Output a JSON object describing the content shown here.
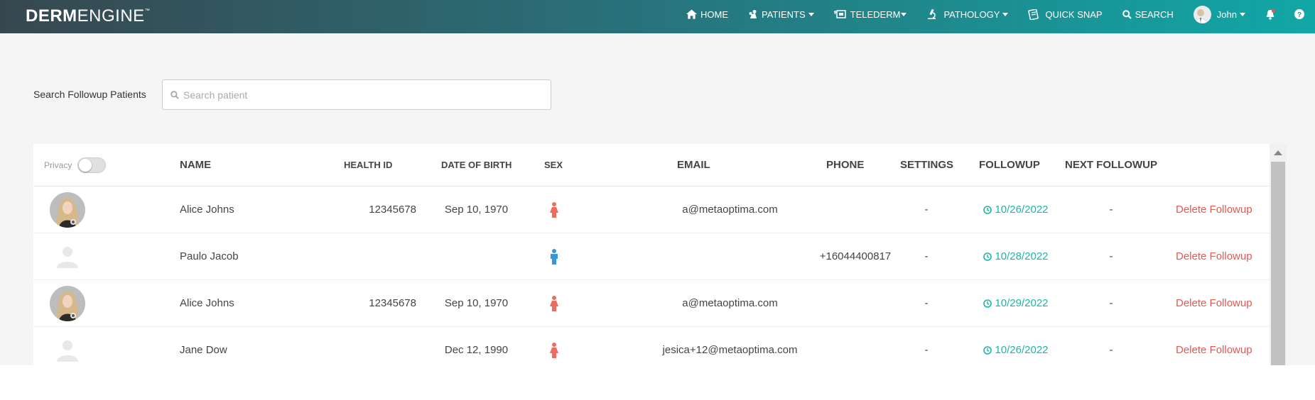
{
  "brand": {
    "bold": "DERM",
    "light": "ENGINE",
    "tm": "™"
  },
  "nav": {
    "home": "HOME",
    "patients": "PATIENTS",
    "telederm": "TELEDERM",
    "pathology": "PATHOLOGY",
    "quick_snap": "QUICK SNAP",
    "search": "SEARCH",
    "user": "John"
  },
  "search": {
    "label": "Search Followup Patients",
    "placeholder": "Search patient",
    "value": ""
  },
  "table": {
    "privacy_label": "Privacy",
    "privacy_on": false,
    "headers": {
      "name": "NAME",
      "health_id": "HEALTH ID",
      "dob": "DATE OF BIRTH",
      "sex": "SEX",
      "email": "EMAIL",
      "phone": "PHONE",
      "settings": "SETTINGS",
      "followup": "FOLLOWUP",
      "next_followup": "NEXT FOLLOWUP"
    },
    "rows": [
      {
        "name": "Alice Johns",
        "health_id": "12345678",
        "dob": "Sep 10, 1970",
        "sex": "female",
        "email": "a@metaoptima.com",
        "phone": "",
        "settings": "-",
        "followup": "10/26/2022",
        "next_followup": "-",
        "action": "Delete Followup",
        "has_photo": true
      },
      {
        "name": "Paulo Jacob",
        "health_id": "",
        "dob": "",
        "sex": "male",
        "email": "",
        "phone": "+16044400817",
        "settings": "-",
        "followup": "10/28/2022",
        "next_followup": "-",
        "action": "Delete Followup",
        "has_photo": false
      },
      {
        "name": "Alice Johns",
        "health_id": "12345678",
        "dob": "Sep 10, 1970",
        "sex": "female",
        "email": "a@metaoptima.com",
        "phone": "",
        "settings": "-",
        "followup": "10/29/2022",
        "next_followup": "-",
        "action": "Delete Followup",
        "has_photo": true
      },
      {
        "name": "Jane Dow",
        "health_id": "",
        "dob": "Dec 12, 1990",
        "sex": "female",
        "email": "jesica+12@metaoptima.com",
        "phone": "",
        "settings": "-",
        "followup": "10/26/2022",
        "next_followup": "-",
        "action": "Delete Followup",
        "has_photo": false
      }
    ]
  },
  "colors": {
    "accent": "#1bb6a8",
    "delete": "#e9574f",
    "female": "#ef6b5f",
    "male": "#3a95d4",
    "nav_start": "#37474f",
    "nav_end": "#11a7a6"
  },
  "icons": {
    "home": "home-icon",
    "patients": "patients-icon",
    "telederm": "telederm-icon",
    "pathology": "microscope-icon",
    "quick_snap": "quick-snap-icon",
    "search": "search-icon",
    "notifications": "bell-icon",
    "help": "help-icon"
  }
}
